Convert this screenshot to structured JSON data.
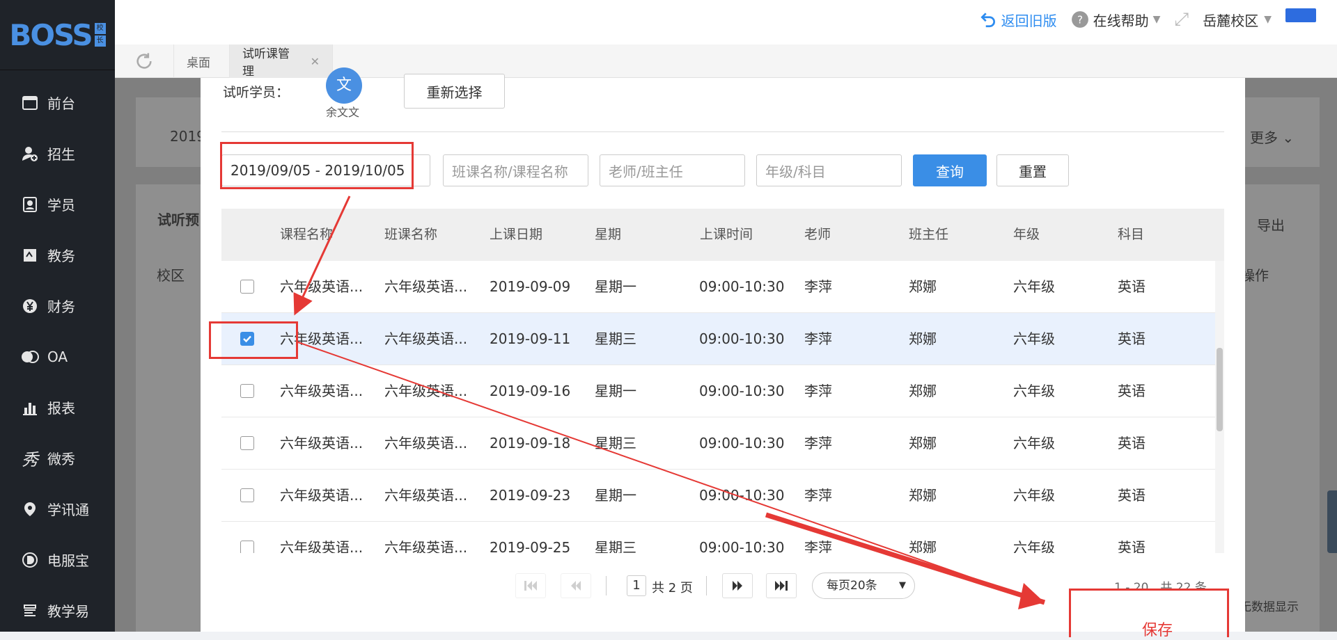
{
  "brand": {
    "logo_text": "BOSS",
    "badge_top": "校",
    "badge_bottom": "长"
  },
  "sidebar": {
    "items": [
      {
        "label": "前台",
        "icon": "calendar-icon"
      },
      {
        "label": "招生",
        "icon": "user-add-icon"
      },
      {
        "label": "学员",
        "icon": "id-card-icon"
      },
      {
        "label": "教务",
        "icon": "book-icon"
      },
      {
        "label": "财务",
        "icon": "yen-icon"
      },
      {
        "label": "OA",
        "icon": "oa-icon"
      },
      {
        "label": "报表",
        "icon": "bar-chart-icon"
      },
      {
        "label": "微秀",
        "icon": "weixiu-icon"
      },
      {
        "label": "学讯通",
        "icon": "location-icon"
      },
      {
        "label": "电服宝",
        "icon": "phone-service-icon"
      },
      {
        "label": "教学易",
        "icon": "teaching-icon"
      }
    ]
  },
  "topbar": {
    "back_label": "返回旧版",
    "help_label": "在线帮助",
    "campus_label": "岳麓校区"
  },
  "tabs": [
    {
      "label": "桌面"
    },
    {
      "label": "试听课管理"
    }
  ],
  "background": {
    "date_fragment": "2019",
    "more_label": "更多",
    "title_fragment": "试听预",
    "export_label": "导出",
    "campus_col": "校区",
    "op_fragment": "操作",
    "show_fragment": "无数据显示"
  },
  "modal": {
    "student_label": "试听学员：",
    "student_avatar_char": "文",
    "student_name": "余文文",
    "reselect_label": "重新选择",
    "filters": {
      "date_range": "2019/09/05 - 2019/10/05",
      "course_placeholder": "班课名称/课程名称",
      "teacher_placeholder": "老师/班主任",
      "grade_placeholder": "年级/科目",
      "query_label": "查询",
      "reset_label": "重置"
    },
    "table": {
      "headers": [
        "课程名称",
        "班课名称",
        "上课日期",
        "星期",
        "上课时间",
        "老师",
        "班主任",
        "年级",
        "科目"
      ],
      "rows": [
        {
          "checked": false,
          "course": "六年级英语...",
          "class": "六年级英语...",
          "date": "2019-09-09",
          "weekday": "星期一",
          "time": "09:00-10:30",
          "teacher": "李萍",
          "head": "郑娜",
          "grade": "六年级",
          "subject": "英语"
        },
        {
          "checked": true,
          "course": "六年级英语...",
          "class": "六年级英语...",
          "date": "2019-09-11",
          "weekday": "星期三",
          "time": "09:00-10:30",
          "teacher": "李萍",
          "head": "郑娜",
          "grade": "六年级",
          "subject": "英语"
        },
        {
          "checked": false,
          "course": "六年级英语...",
          "class": "六年级英语...",
          "date": "2019-09-16",
          "weekday": "星期一",
          "time": "09:00-10:30",
          "teacher": "李萍",
          "head": "郑娜",
          "grade": "六年级",
          "subject": "英语"
        },
        {
          "checked": false,
          "course": "六年级英语...",
          "class": "六年级英语...",
          "date": "2019-09-18",
          "weekday": "星期三",
          "time": "09:00-10:30",
          "teacher": "李萍",
          "head": "郑娜",
          "grade": "六年级",
          "subject": "英语"
        },
        {
          "checked": false,
          "course": "六年级英语...",
          "class": "六年级英语...",
          "date": "2019-09-23",
          "weekday": "星期一",
          "time": "09:00-10:30",
          "teacher": "李萍",
          "head": "郑娜",
          "grade": "六年级",
          "subject": "英语"
        },
        {
          "checked": false,
          "course": "六年级英语...",
          "class": "六年级英语...",
          "date": "2019-09-25",
          "weekday": "星期三",
          "time": "09:00-10:30",
          "teacher": "李萍",
          "head": "郑娜",
          "grade": "六年级",
          "subject": "英语"
        }
      ]
    },
    "pagination": {
      "page": "1",
      "total_pages": "共 2 页",
      "page_size": "每页20条",
      "range": "1 - 20，共 22 条"
    },
    "save_label": "保存"
  },
  "colors": {
    "accent": "#3a8ee6",
    "annotation": "#e53935",
    "sidebar_bg": "#1f2329"
  }
}
